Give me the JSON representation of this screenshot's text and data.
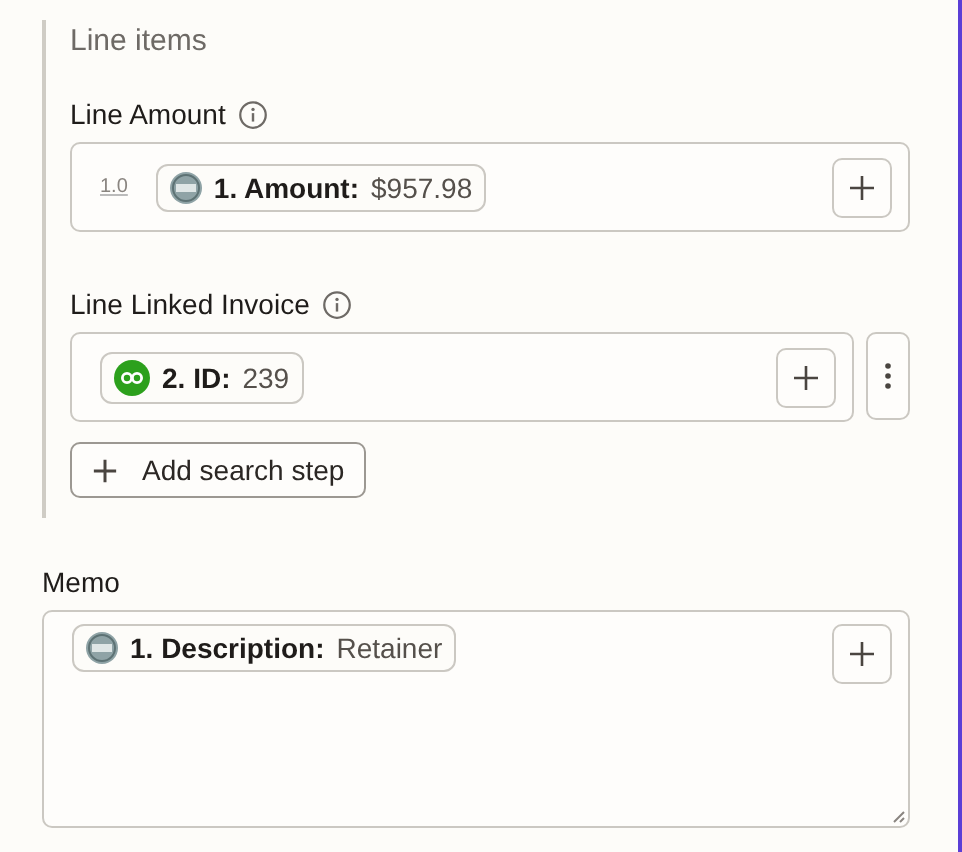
{
  "section": {
    "title": "Line items",
    "fields": [
      {
        "label": "Line Amount",
        "info": true,
        "type_hint": "1.0",
        "more_menu": false,
        "tokens": [
          {
            "kind": "generic",
            "step": "1. Amount:",
            "value": "$957.98"
          }
        ]
      },
      {
        "label": "Line Linked Invoice",
        "info": true,
        "more_menu": true,
        "tokens": [
          {
            "kind": "quickbooks",
            "step": "2. ID:",
            "value": "239"
          }
        ]
      }
    ],
    "add_button": {
      "label": "Add search step"
    }
  },
  "memo": {
    "label": "Memo",
    "multiline": true,
    "tokens": [
      {
        "kind": "generic",
        "step": "1. Description:",
        "value": "Retainer"
      }
    ]
  }
}
